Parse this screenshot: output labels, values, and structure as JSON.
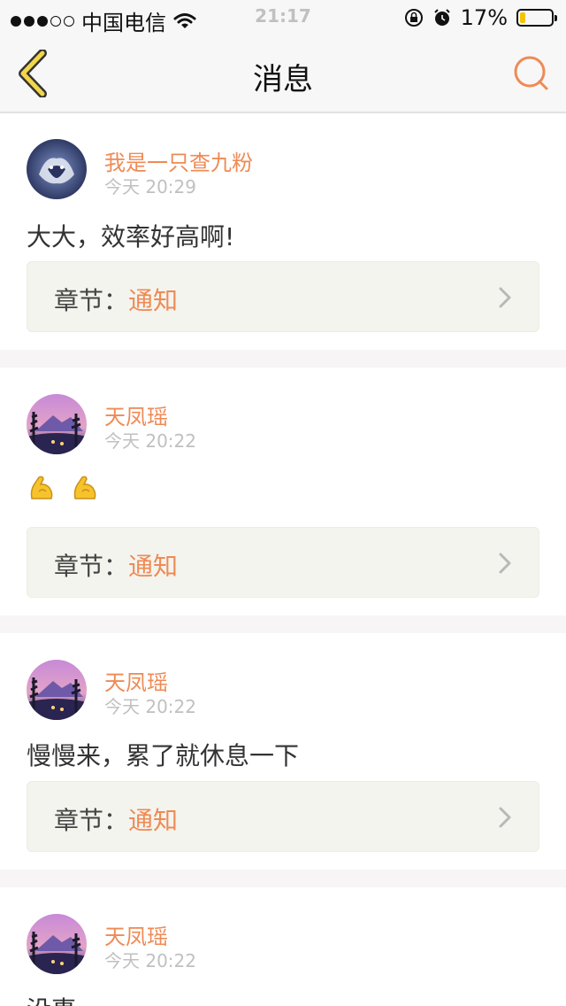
{
  "status_bar": {
    "carrier": "中国电信",
    "time": "21:17",
    "battery": "17%",
    "battery_level": 0.17,
    "signal_dots_filled": 3,
    "signal_dots_total": 5,
    "icons": [
      "wifi-icon",
      "rotation-lock-icon",
      "alarm-icon",
      "battery-icon"
    ]
  },
  "nav": {
    "title": "消息",
    "back_icon": "chevron-left-icon",
    "search_icon": "search-icon",
    "accent": "#ef8a55"
  },
  "messages": [
    {
      "author": "我是一只查九粉",
      "time": "今天 20:29",
      "text": "大大，效率好高啊!",
      "chapter_label": "章节：",
      "chapter_value": "通知",
      "avatar": "wolf-avatar"
    },
    {
      "author": "天凤瑶",
      "time": "今天 20:22",
      "text": "",
      "emoji": [
        "flexed-biceps-emoji",
        "flexed-biceps-emoji"
      ],
      "chapter_label": "章节：",
      "chapter_value": "通知",
      "avatar": "landscape-avatar"
    },
    {
      "author": "天凤瑶",
      "time": "今天 20:22",
      "text": "慢慢来，累了就休息一下",
      "chapter_label": "章节：",
      "chapter_value": "通知",
      "avatar": "landscape-avatar"
    },
    {
      "author": "天凤瑶",
      "time": "今天 20:22",
      "text": "没事",
      "avatar": "landscape-avatar"
    }
  ]
}
